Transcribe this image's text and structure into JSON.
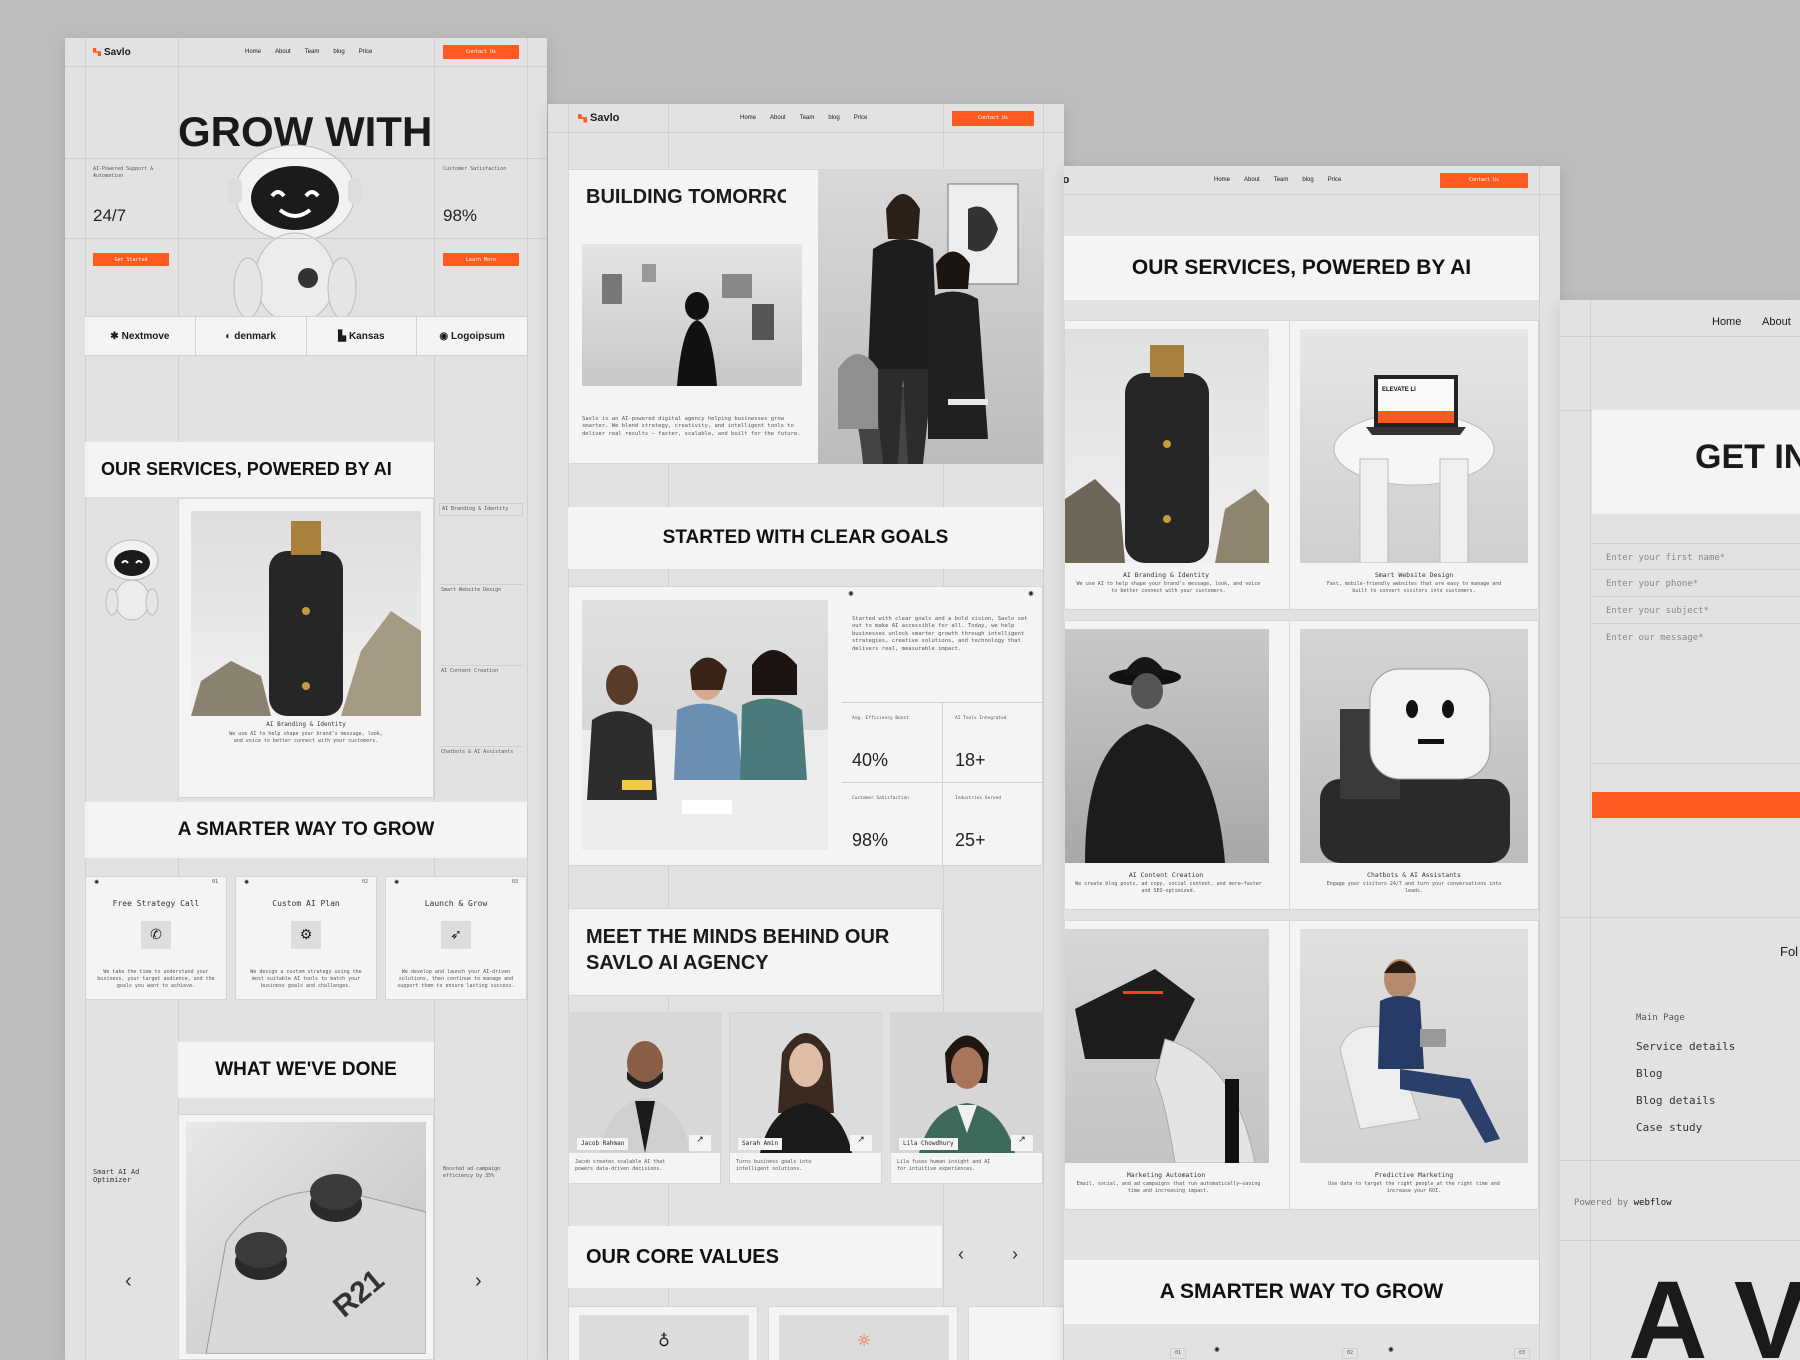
{
  "brand": {
    "name": "Savlo",
    "accent": "#ff5a1f"
  },
  "nav": {
    "items": [
      "Home",
      "About",
      "Team",
      "blog",
      "Price"
    ],
    "contact": "Contact Us"
  },
  "p1": {
    "hero_title": "GROW WITH",
    "left_label": "AI-Powered Support & Automation",
    "left_stat": "24/7",
    "right_label": "Customer Satisfaction",
    "right_stat": "98%",
    "get_started": "Get Started",
    "learn_more": "Learn More",
    "logos": [
      "Nextmove",
      "denmark",
      "Kansas",
      "Logoipsum"
    ],
    "services_title": "OUR SERVICES, POWERED BY AI",
    "service_card_title": "AI Branding & Identity",
    "service_card_desc": "We use AI to help shape your brand's message, look, and voice to better connect with your customers.",
    "service_list": [
      "AI Branding & Identity",
      "Smart Website Design",
      "AI Content Creation",
      "Chatbots & AI Assistants"
    ],
    "smarter_title": "A SMARTER WAY TO GROW",
    "steps": [
      {
        "num": "01",
        "title": "Free Strategy Call",
        "desc": "We take the time to understand your business, your target audience, and the goals you want to achieve."
      },
      {
        "num": "02",
        "title": "Custom AI Plan",
        "desc": "We design a custom strategy using the most suitable AI tools to match your business goals and challenges."
      },
      {
        "num": "03",
        "title": "Launch & Grow",
        "desc": "We develop and launch your AI-driven solutions, then continue to manage and support them to ensure lasting success."
      }
    ],
    "done_title": "WHAT WE'VE DONE",
    "done_left": "Smart AI Ad Optimizer",
    "done_right": "Boosted ad campaign efficiency by 35%",
    "prev": "‹",
    "next": "›"
  },
  "p2": {
    "building_title": "BUILDING TOMORROW",
    "about_desc": "Savlo is an AI-powered digital agency helping businesses grow smarter. We blend strategy, creativity, and intelligent tools to deliver real results — faster, scalable, and built for the future.",
    "goals_title": "STARTED WITH CLEAR GOALS",
    "goals_desc": "Started with clear goals and a bold vision, Savlo set out to make AI accessible for all. Today, we help businesses unlock smarter growth through intelligent strategies, creative solutions, and technology that delivers real, measurable impact.",
    "stats": [
      {
        "label": "Avg. Efficiency Boost",
        "value": "40%"
      },
      {
        "label": "AI Tools Integrated",
        "value": "18+"
      },
      {
        "label": "Customer Satisfaction",
        "value": "98%"
      },
      {
        "label": "Industries Served",
        "value": "25+"
      }
    ],
    "minds_title_1": "MEET THE MINDS BEHIND OUR",
    "minds_title_2": "SAVLO AI AGENCY",
    "team": [
      {
        "name": "Jacob Rahman",
        "desc": "Jacob creates scalable AI that powers data-driven decisions."
      },
      {
        "name": "Sarah Amin",
        "desc": "Turns business goals into intelligent solutions."
      },
      {
        "name": "Lila Chowdhury",
        "desc": "Lila fuses human insight and AI for intuitive experiences."
      }
    ],
    "values_title": "OUR CORE VALUES",
    "prev": "‹",
    "next": "›"
  },
  "p3": {
    "services_title": "OUR SERVICES, POWERED BY AI",
    "services": [
      {
        "title": "AI Branding & Identity",
        "desc": "We use AI to help shape your brand's message, look, and voice to better connect with your customers."
      },
      {
        "title": "Smart Website Design",
        "desc": "Fast, mobile-friendly websites that are easy to manage and built to convert visitors into customers."
      },
      {
        "title": "AI Content Creation",
        "desc": "We create blog posts, ad copy, social content, and more—faster and SEO-optimized."
      },
      {
        "title": "Chatbots & AI Assistants",
        "desc": "Engage your visitors 24/7 and turn your conversations into leads."
      },
      {
        "title": "Marketing Automation",
        "desc": "Email, social, and ad campaigns that run automatically—saving time and increasing impact."
      },
      {
        "title": "Predictive Marketing",
        "desc": "Use data to target the right people at the right time and increase your ROI."
      }
    ],
    "laptop_text": "ELEVATE LI",
    "smarter_title": "A SMARTER WAY TO GROW",
    "step_nums": [
      "01",
      "02",
      "03"
    ]
  },
  "p4": {
    "nav_home": "Home",
    "nav_about": "About",
    "get_title": "GET IN",
    "fields": [
      "Enter your first name*",
      "Enter your phone*",
      "Enter your subject*",
      "Enter our message*"
    ],
    "follow": "Fol",
    "footer_heading": "Main Page",
    "footer_links": [
      "Service details",
      "Blog",
      "Blog details",
      "Case study"
    ],
    "powered_by": "Powered by",
    "powered_brand": "webflow",
    "big_letters": "A V"
  }
}
